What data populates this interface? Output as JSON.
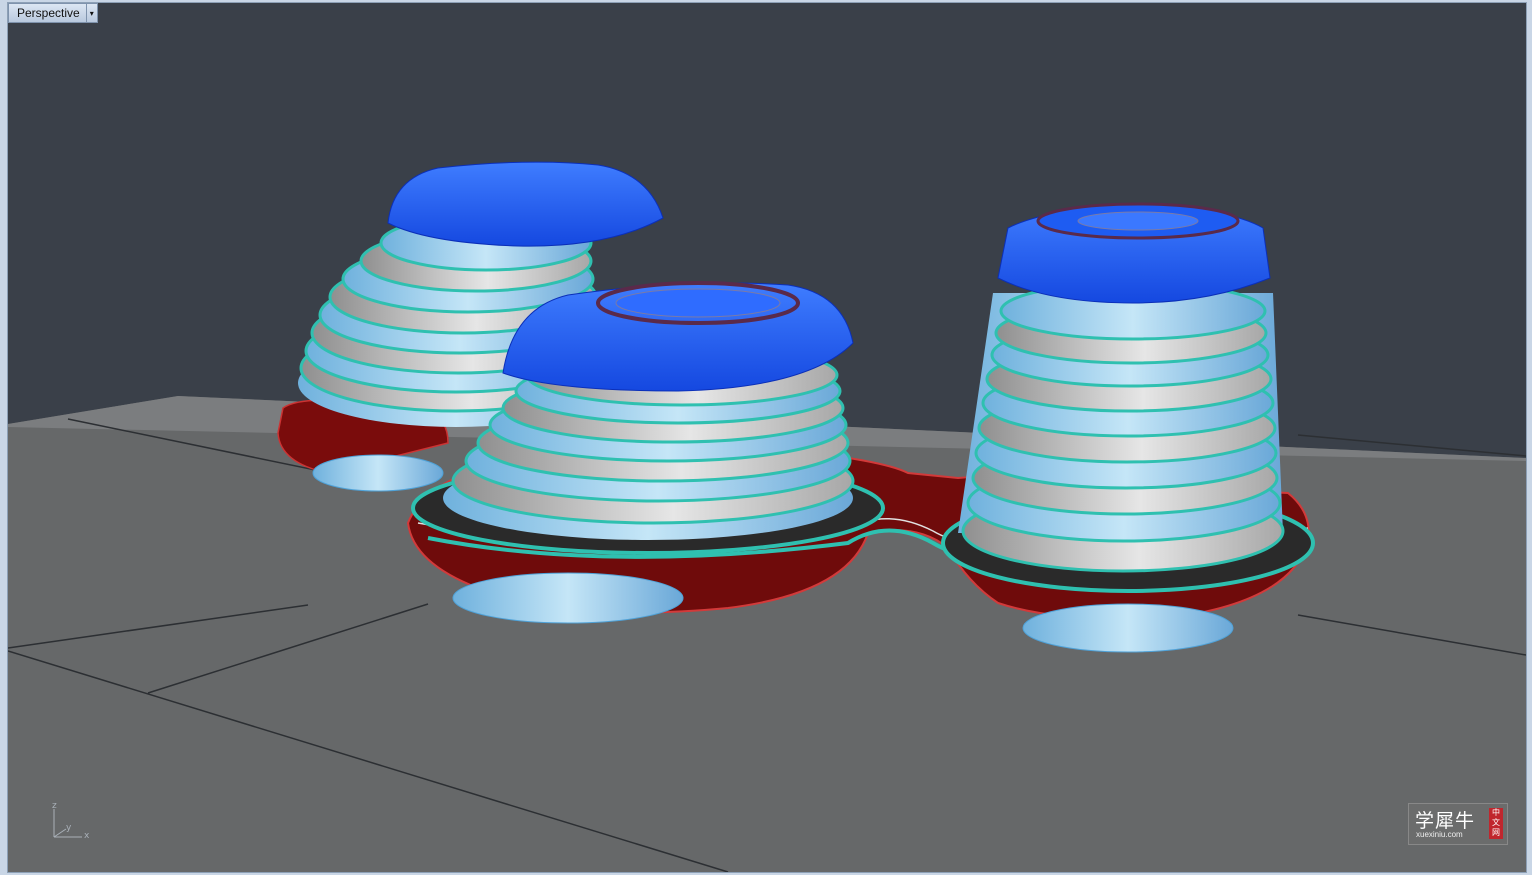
{
  "viewport": {
    "name": "Perspective",
    "menu_arrow": "▾"
  },
  "axis": {
    "z": "z",
    "y": "y",
    "x": "x"
  },
  "watermark": {
    "title": "学犀牛",
    "url": "xuexiniu.com",
    "stamp": "中文网"
  },
  "colors": {
    "background": "#3a4049",
    "ground": "#666869",
    "roof": "#1e62f5",
    "floor_slab": "#cfcfcf",
    "railing": "#2fc0b0",
    "glass": "#9fd0ec",
    "podium": "#8a0e0e"
  }
}
